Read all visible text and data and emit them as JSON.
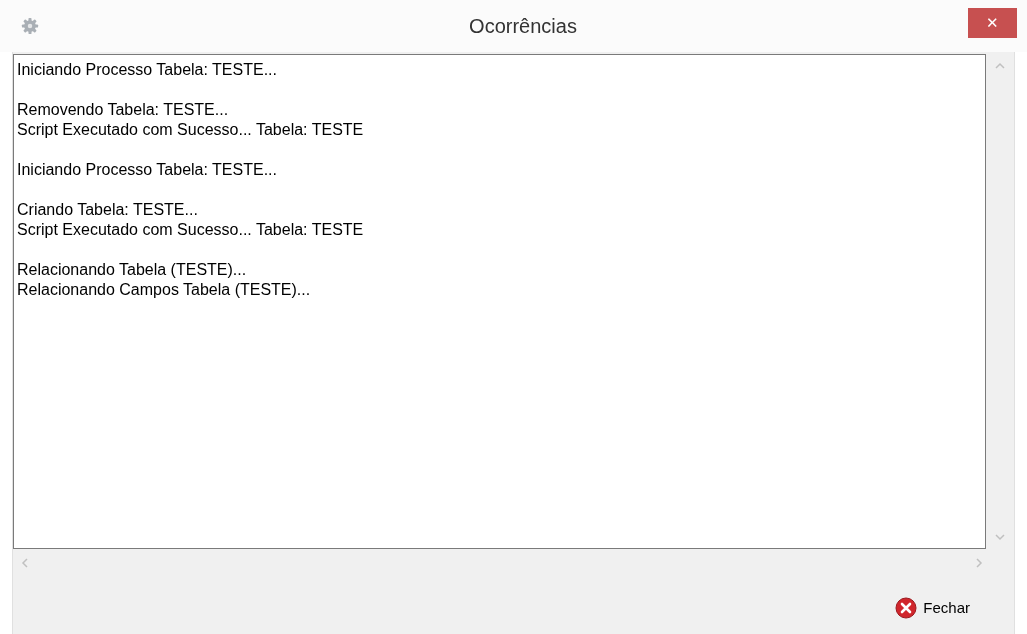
{
  "window": {
    "title": "Ocorrências",
    "close_glyph": "✕"
  },
  "log": {
    "blocks": [
      [
        "Iniciando Processo Tabela: TESTE..."
      ],
      [
        "Removendo Tabela: TESTE...",
        "Script Executado com Sucesso... Tabela: TESTE"
      ],
      [
        "Iniciando Processo Tabela: TESTE..."
      ],
      [
        "Criando Tabela: TESTE...",
        "Script Executado com Sucesso... Tabela: TESTE"
      ],
      [
        "Relacionando Tabela (TESTE)...",
        "Relacionando Campos Tabela (TESTE)..."
      ]
    ]
  },
  "buttons": [
    {
      "label": "Fechar",
      "kind": "close"
    }
  ]
}
